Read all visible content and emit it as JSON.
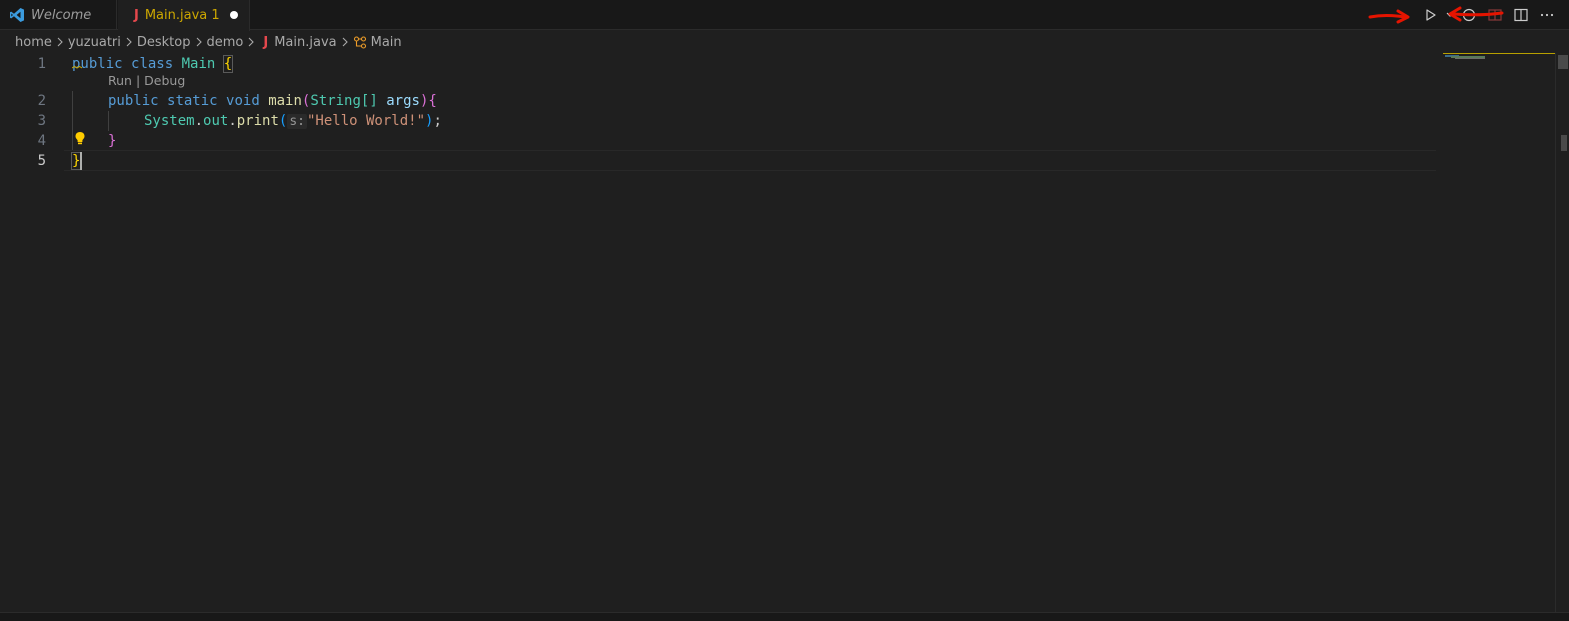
{
  "tabs": [
    {
      "label": "Welcome",
      "icon": "vscode-logo-icon"
    },
    {
      "label": "Main.java",
      "problems": "1",
      "icon": "java-file-icon",
      "dirty": true
    }
  ],
  "breadcrumb": {
    "items": [
      "home",
      "yuzuatri",
      "Desktop",
      "demo",
      "Main.java",
      "Main"
    ]
  },
  "codelens": {
    "run": "Run",
    "separator": "|",
    "debug": "Debug"
  },
  "line_numbers": [
    "1",
    "2",
    "3",
    "4",
    "5"
  ],
  "code": {
    "l1_public": "public",
    "l1_class": "class",
    "l1_name": "Main",
    "l1_brace": "{",
    "l2_public": "public",
    "l2_static": "static",
    "l2_void": "void",
    "l2_main": "main",
    "l2_paren_open": "(",
    "l2_type": "String[]",
    "l2_arg": "args",
    "l2_paren_close": ")",
    "l2_brace": "{",
    "l3_system": "System",
    "l3_dot1": ".",
    "l3_out": "out",
    "l3_dot2": ".",
    "l3_print": "print",
    "l3_paren_open": "(",
    "l3_hint": "s:",
    "l3_string": "\"Hello World!\"",
    "l3_paren_close": ")",
    "l3_semicolon": ";",
    "l4_brace": "}",
    "l5_brace": "}"
  },
  "colors": {
    "background": "#1f1f1f",
    "tab_modified": "#cca700",
    "keyword": "#569cd6",
    "type": "#4ec9b0",
    "function": "#dcdcaa",
    "string": "#ce9178",
    "annotation_arrow": "#e51400"
  }
}
